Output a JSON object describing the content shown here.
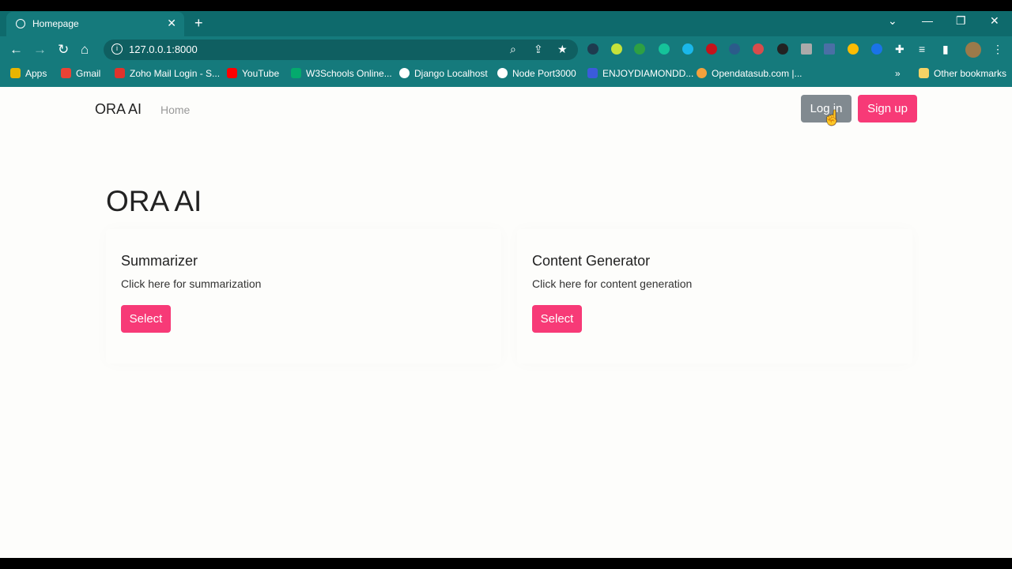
{
  "browser": {
    "tab_title": "Homepage",
    "tab_close": "✕",
    "new_tab": "+",
    "url": "127.0.0.1:8000",
    "window_controls": [
      "⌄",
      "—",
      "❐",
      "✕"
    ],
    "bookmarks": [
      {
        "label": "Apps",
        "icon": "apps-grid-icon",
        "color": "#e8b500"
      },
      {
        "label": "Gmail",
        "icon": "gmail-icon",
        "color": "#ea4335"
      },
      {
        "label": "Zoho Mail Login - S...",
        "icon": "zoho-icon",
        "color": "#e0332c"
      },
      {
        "label": "YouTube",
        "icon": "youtube-icon",
        "color": "#ff0000"
      },
      {
        "label": "W3Schools Online...",
        "icon": "w3schools-icon",
        "color": "#04aa6d"
      },
      {
        "label": "Django Localhost",
        "icon": "globe-icon",
        "color": "#ffffff"
      },
      {
        "label": "Node Port3000",
        "icon": "globe-icon",
        "color": "#ffffff"
      },
      {
        "label": "ENJOYDIAMONDD...",
        "icon": "enjoy-icon",
        "color": "#3b5bdb"
      },
      {
        "label": "Opendatasub.com |...",
        "icon": "opendata-icon",
        "color": "#f4a13c"
      }
    ],
    "bookmarks_more": "»",
    "other_bookmarks": "Other bookmarks"
  },
  "nav": {
    "brand": "ORA AI",
    "home": "Home",
    "login": "Log in",
    "signup": "Sign up"
  },
  "main": {
    "heading": "ORA AI",
    "cards": [
      {
        "title": "Summarizer",
        "text": "Click here for summarization",
        "button": "Select"
      },
      {
        "title": "Content Generator",
        "text": "Click here for content generation",
        "button": "Select"
      }
    ]
  },
  "colors": {
    "accent": "#f73a77",
    "login_bg": "#818a90",
    "browser_chrome": "#157a7c"
  }
}
